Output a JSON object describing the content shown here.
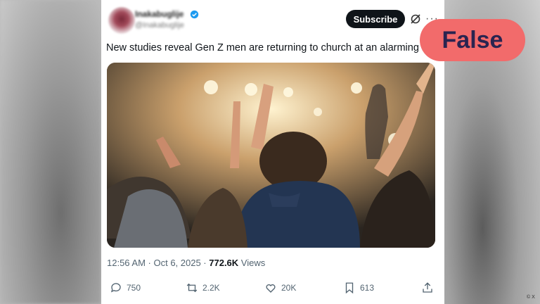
{
  "post": {
    "author_name": "Inakabuglije",
    "author_handle": "@Inakabuglije",
    "subscribe_label": "Subscribe",
    "text": "New studies reveal Gen Z men are returning to church at an alarming ra",
    "timestamp": "12:56 AM · Oct 6, 2025 · ",
    "views_count": "772.6K",
    "views_label": " Views",
    "actions": {
      "replies": "750",
      "reposts": "2.2K",
      "likes": "20K",
      "bookmarks": "613"
    },
    "icons": [
      "verified-icon",
      "grok-icon",
      "more-icon",
      "reply-icon",
      "repost-icon",
      "like-icon",
      "bookmark-icon",
      "share-icon"
    ]
  },
  "fact_check": {
    "label": "False",
    "color": "#f26b6b"
  },
  "watermark": "© X"
}
